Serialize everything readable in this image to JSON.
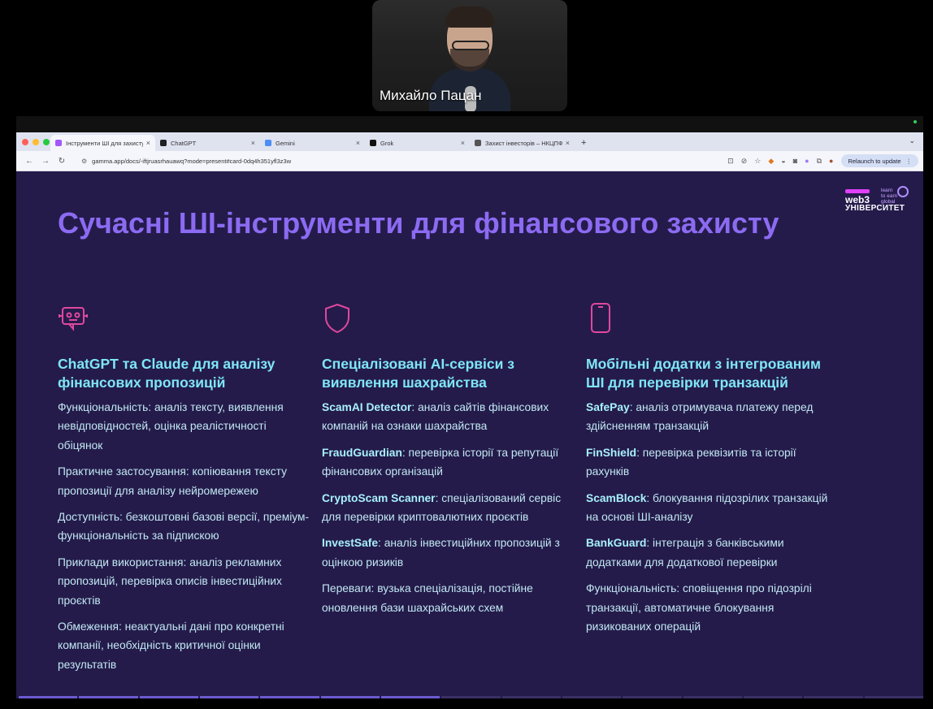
{
  "meeting": {
    "speaker_name": "Михайло Пацан"
  },
  "browser": {
    "tabs": [
      {
        "label": "Інструменти ШІ для захисту",
        "active": true,
        "favicon_color": "#a259ff"
      },
      {
        "label": "ChatGPT",
        "active": false,
        "favicon_color": "#202123"
      },
      {
        "label": "Gemini",
        "active": false,
        "favicon_color": "#4c8df6"
      },
      {
        "label": "Grok",
        "active": false,
        "favicon_color": "#111111"
      },
      {
        "label": "Захист інвесторів – НКЦПФР",
        "active": false,
        "favicon_color": "#555555"
      }
    ],
    "tab_close": "×",
    "new_tab": "+",
    "url": "gamma.app/docs/-iftjruasrhauawq?mode=present#card-0dq4h351yfl3z3w",
    "relaunch_label": "Relaunch to update"
  },
  "slide": {
    "logo": {
      "brand": "web3",
      "university": "УНІВЕРСИТЕТ",
      "tagline": [
        "learn",
        "to earn",
        "global"
      ]
    },
    "title": "Сучасні ШІ-інструменти для фінансового захисту",
    "columns": [
      {
        "icon": "chatbot-icon",
        "heading": "ChatGPT та Claude для аналізу фінансових пропозицій",
        "items": [
          {
            "bold": "",
            "text": "Функціональність: аналіз тексту, виявлення невідповідностей, оцінка реалістичності обіцянок"
          },
          {
            "bold": "",
            "text": "Практичне застосування: копіювання тексту пропозиції для аналізу нейромережею"
          },
          {
            "bold": "",
            "text": "Доступність: безкоштовні базові версії, преміум-функціональність за підпискою"
          },
          {
            "bold": "",
            "text": "Приклади використання: аналіз рекламних пропозицій, перевірка описів інвестиційних проєктів"
          },
          {
            "bold": "",
            "text": "Обмеження: неактуальні дані про конкретні компанії, необхідність критичної оцінки результатів"
          }
        ]
      },
      {
        "icon": "shield-icon",
        "heading": "Спеціалізовані AI-сервіси з виявлення шахрайства",
        "items": [
          {
            "bold": "ScamAI Detector",
            "text": ": аналіз сайтів фінансових компаній на ознаки шахрайства"
          },
          {
            "bold": "FraudGuardian",
            "text": ": перевірка історії та репутації фінансових організацій"
          },
          {
            "bold": "CryptoScam Scanner",
            "text": ": спеціалізований сервіс для перевірки криптовалютних проєктів"
          },
          {
            "bold": "InvestSafe",
            "text": ": аналіз інвестиційних пропозицій з оцінкою ризиків"
          },
          {
            "bold": "",
            "text": "Переваги: вузька спеціалізація, постійне оновлення бази шахрайських схем"
          }
        ]
      },
      {
        "icon": "smartphone-icon",
        "heading": "Мобільні додатки з інтегрованим ШІ для перевірки транзакцій",
        "items": [
          {
            "bold": "SafePay",
            "text": ": аналіз отримувача платежу перед здійсненням транзакцій"
          },
          {
            "bold": "FinShield",
            "text": ": перевірка реквізитів та історії рахунків"
          },
          {
            "bold": "ScamBlock",
            "text": ": блокування підозрілих транзакцій на основі ШІ-аналізу"
          },
          {
            "bold": "BankGuard",
            "text": ": інтеграція з банківськими додатками для додаткової перевірки"
          },
          {
            "bold": "",
            "text": "Функціональність: сповіщення про підозрілі транзакції, автоматичне блокування ризикованих операцій"
          }
        ]
      }
    ],
    "progress": {
      "current": 7,
      "total": 15
    },
    "colors": {
      "background": "#241b4b",
      "title": "#8c6bf2",
      "heading": "#7fe6f6",
      "body": "#c2e8f2",
      "icon_pink": "#e0489e"
    }
  }
}
